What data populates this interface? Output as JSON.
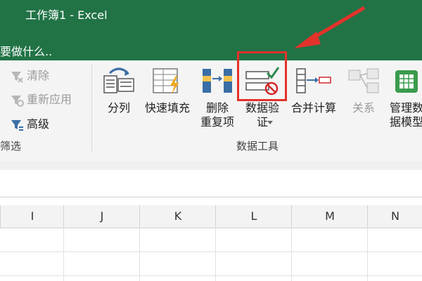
{
  "window": {
    "title": "工作簿1 - Excel"
  },
  "tell_me": {
    "text": "要做什么.."
  },
  "sort_filter": {
    "items": [
      {
        "label": "清除",
        "enabled": false
      },
      {
        "label": "重新应用",
        "enabled": false
      },
      {
        "label": "高级",
        "enabled": true
      }
    ],
    "group_label": "筛选"
  },
  "data_tools": {
    "group_label": "数据工具",
    "buttons": [
      {
        "label_line1": "分列",
        "label_line2": "",
        "icon": "text-to-columns-icon",
        "enabled": true
      },
      {
        "label_line1": "快速填充",
        "label_line2": "",
        "icon": "flash-fill-icon",
        "enabled": true
      },
      {
        "label_line1": "删除",
        "label_line2": "重复项",
        "icon": "remove-duplicates-icon",
        "enabled": true
      },
      {
        "label_line1": "数据验",
        "label_line2": "证",
        "icon": "data-validation-icon",
        "enabled": true,
        "has_dropdown": true
      },
      {
        "label_line1": "合并计算",
        "label_line2": "",
        "icon": "consolidate-icon",
        "enabled": true
      },
      {
        "label_line1": "关系",
        "label_line2": "",
        "icon": "relationships-icon",
        "enabled": false
      },
      {
        "label_line1": "管理数",
        "label_line2": "据模型",
        "icon": "manage-data-model-icon",
        "enabled": true
      }
    ]
  },
  "columns": [
    "I",
    "J",
    "K",
    "L",
    "M",
    "N"
  ],
  "colors": {
    "excel_green": "#217346",
    "highlight_red": "#e3322b"
  }
}
